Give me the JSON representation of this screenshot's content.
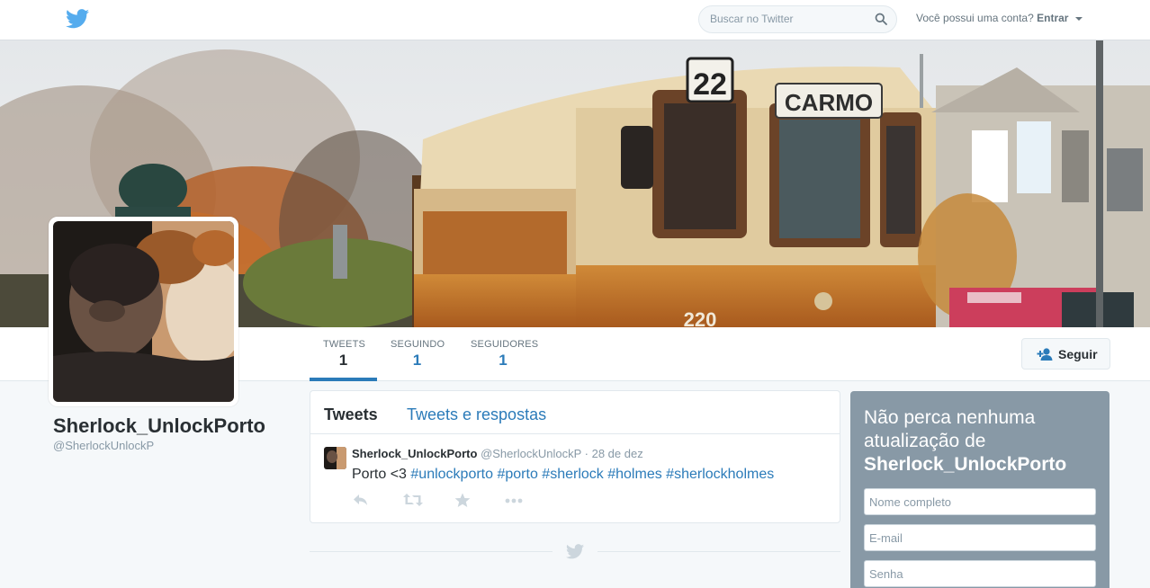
{
  "topbar": {
    "logo_icon": "twitter-bird-icon",
    "search_placeholder": "Buscar no Twitter",
    "search_icon": "search-icon",
    "login_prompt": "Você possui uma conta?",
    "login_label": "Entrar"
  },
  "profile": {
    "name": "Sherlock_UnlockPorto",
    "handle": "@SherlockUnlockP"
  },
  "nav": {
    "stats": [
      {
        "label": "TWEETS",
        "value": "1"
      },
      {
        "label": "SEGUINDO",
        "value": "1"
      },
      {
        "label": "SEGUIDORES",
        "value": "1"
      }
    ],
    "follow_label": "Seguir",
    "follow_icon": "add-user-icon"
  },
  "timeline": {
    "tabs": [
      "Tweets",
      "Tweets e respostas"
    ],
    "tweet": {
      "name": "Sherlock_UnlockPorto",
      "handle": "@SherlockUnlockP",
      "separator": "·",
      "date": "28 de dez",
      "text": "Porto <3",
      "hashtags": [
        "#unlockporto",
        "#porto",
        "#sherlock",
        "#holmes",
        "#sherlockholmes"
      ],
      "actions": [
        "reply-icon",
        "retweet-icon",
        "favorite-icon",
        "more-icon"
      ]
    },
    "end_icon": "twitter-bird-icon"
  },
  "signup": {
    "title_prefix": "Não perca nenhuma atualização de",
    "title_name": "Sherlock_UnlockPorto",
    "name_placeholder": "Nome completo",
    "email_placeholder": "E-mail",
    "password_placeholder": "Senha"
  },
  "banner": {
    "tram_number": "22",
    "tram_destination": "CARMO",
    "tram_plate": "220"
  },
  "colors": {
    "accent": "#2b7bb9",
    "bird": "#55acee",
    "signup_bg": "#8899a6",
    "page_bg": "#f5f8fa"
  }
}
